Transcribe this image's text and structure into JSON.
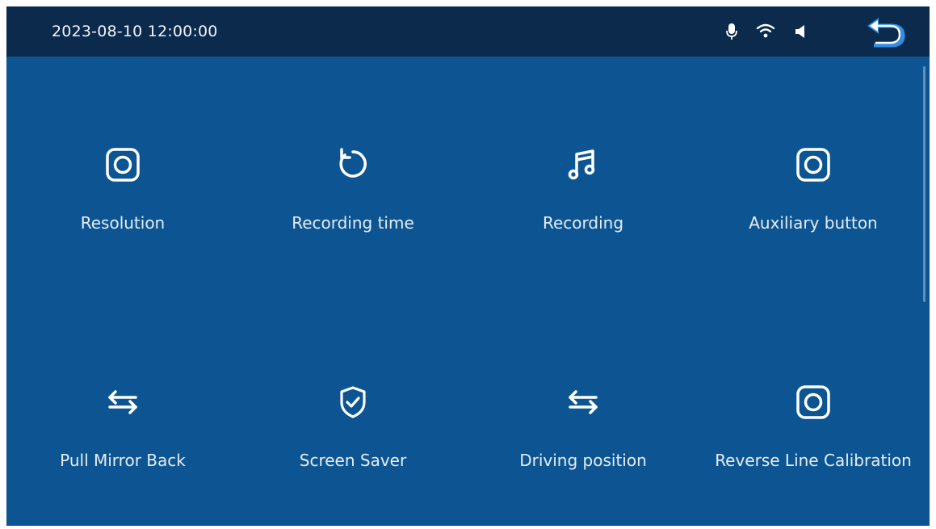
{
  "status_bar": {
    "datetime": "2023-08-10 12:00:00",
    "icons": [
      "microphone-icon",
      "wifi-icon",
      "speaker-icon",
      "back-icon"
    ]
  },
  "menu": {
    "items": [
      {
        "label": "Resolution",
        "icon": "camera-icon"
      },
      {
        "label": "Recording time",
        "icon": "rotate-ccw-icon"
      },
      {
        "label": "Recording",
        "icon": "music-note-icon"
      },
      {
        "label": "Auxiliary button",
        "icon": "camera-icon"
      },
      {
        "label": "Pull Mirror Back",
        "icon": "swap-arrows-icon"
      },
      {
        "label": "Screen Saver",
        "icon": "shield-check-icon"
      },
      {
        "label": "Driving position",
        "icon": "swap-arrows-icon"
      },
      {
        "label": "Reverse Line Calibration",
        "icon": "camera-icon"
      }
    ]
  },
  "colors": {
    "background": "#0c5592",
    "topbar": "#0b2a4c",
    "foreground": "#ffffff",
    "back_accent": "#2f8fe6"
  }
}
